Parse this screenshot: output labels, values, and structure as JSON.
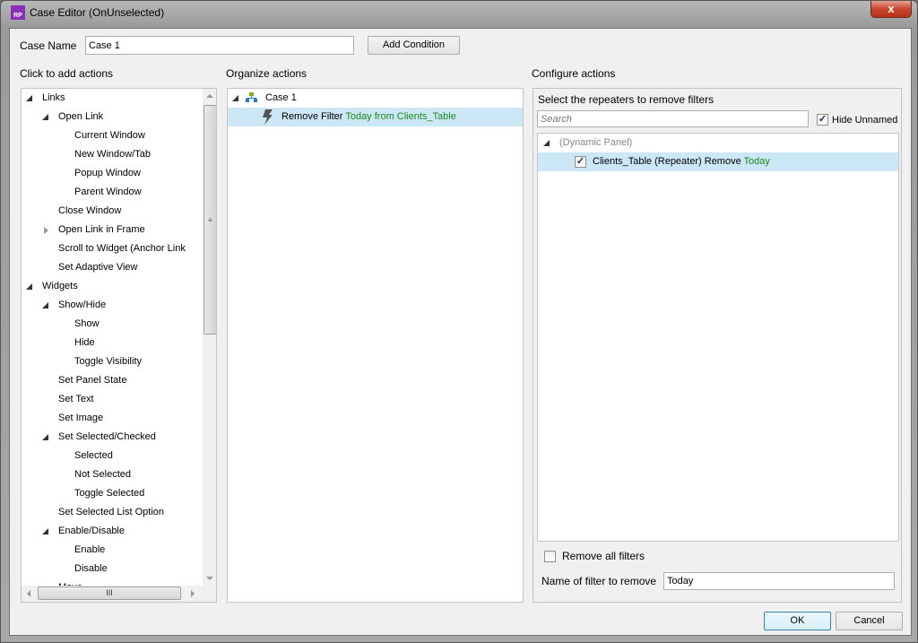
{
  "window": {
    "title": "Case Editor (OnUnselected)",
    "icon_text": "RP",
    "close": "x"
  },
  "case_name": {
    "label": "Case Name",
    "value": "Case 1"
  },
  "add_condition": "Add Condition",
  "left": {
    "header": "Click to add actions",
    "items": [
      {
        "label": "Links",
        "level": 0,
        "expander": "expanded"
      },
      {
        "label": "Open Link",
        "level": 1,
        "expander": "expanded"
      },
      {
        "label": "Current Window",
        "level": 2
      },
      {
        "label": "New Window/Tab",
        "level": 2
      },
      {
        "label": "Popup Window",
        "level": 2
      },
      {
        "label": "Parent Window",
        "level": 2
      },
      {
        "label": "Close Window",
        "level": 1
      },
      {
        "label": "Open Link in Frame",
        "level": 1,
        "expander": "collapsed"
      },
      {
        "label": "Scroll to Widget (Anchor Link",
        "level": 1
      },
      {
        "label": "Set Adaptive View",
        "level": 1
      },
      {
        "label": "Widgets",
        "level": 0,
        "expander": "expanded"
      },
      {
        "label": "Show/Hide",
        "level": 1,
        "expander": "expanded"
      },
      {
        "label": "Show",
        "level": 2
      },
      {
        "label": "Hide",
        "level": 2
      },
      {
        "label": "Toggle Visibility",
        "level": 2
      },
      {
        "label": "Set Panel State",
        "level": 1
      },
      {
        "label": "Set Text",
        "level": 1
      },
      {
        "label": "Set Image",
        "level": 1
      },
      {
        "label": "Set Selected/Checked",
        "level": 1,
        "expander": "expanded"
      },
      {
        "label": "Selected",
        "level": 2
      },
      {
        "label": "Not Selected",
        "level": 2
      },
      {
        "label": "Toggle Selected",
        "level": 2
      },
      {
        "label": "Set Selected List Option",
        "level": 1
      },
      {
        "label": "Enable/Disable",
        "level": 1,
        "expander": "expanded"
      },
      {
        "label": "Enable",
        "level": 2
      },
      {
        "label": "Disable",
        "level": 2
      },
      {
        "label": "Move",
        "level": 1
      }
    ],
    "hscroll_grip": "III"
  },
  "middle": {
    "header": "Organize actions",
    "case_label": "Case 1",
    "action_prefix": "Remove Filter",
    "action_detail": "Today from Clients_Table"
  },
  "right": {
    "header": "Configure actions",
    "subheader": "Select the repeaters to remove filters",
    "search_placeholder": "Search",
    "hide_unnamed": {
      "label": "Hide Unnamed",
      "checked": true
    },
    "tree": {
      "group": "(Dynamic Panel)",
      "item_prefix": "Clients_Table (Repeater) Remove",
      "item_filter": "Today",
      "item_checked": true
    },
    "remove_all": {
      "label": "Remove all filters",
      "checked": false
    },
    "filter_name": {
      "label": "Name of filter to remove",
      "value": "Today"
    }
  },
  "ok": "OK",
  "cancel": "Cancel",
  "colors": {
    "accent_green": "#1d8a1d",
    "selection": "#cce8f6"
  }
}
